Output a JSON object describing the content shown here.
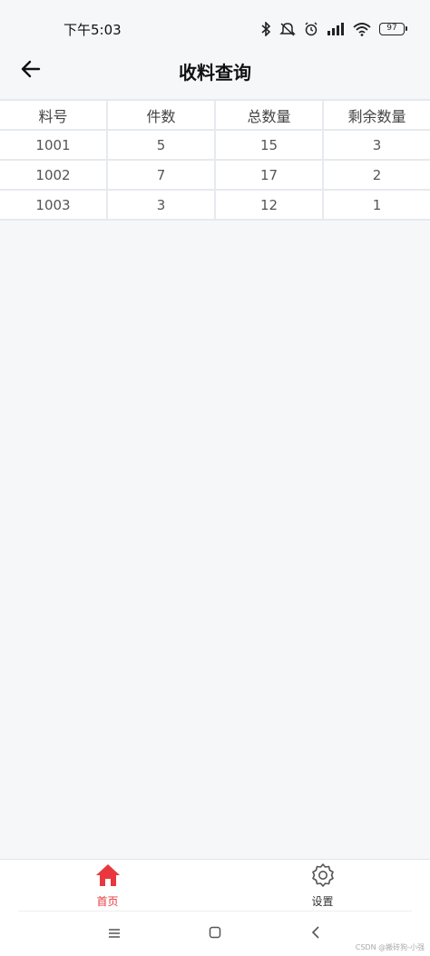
{
  "status_bar": {
    "time": "下午5:03",
    "battery": "97",
    "icons": [
      "bluetooth-icon",
      "mute-icon",
      "alarm-icon",
      "signal-icon",
      "wifi-icon",
      "battery-icon"
    ]
  },
  "app_bar": {
    "title": "收料查询",
    "back_icon": "arrow-left-icon"
  },
  "table": {
    "headers": [
      "料号",
      "件数",
      "总数量",
      "剩余数量"
    ],
    "rows": [
      [
        "1001",
        "5",
        "15",
        "3"
      ],
      [
        "1002",
        "7",
        "17",
        "2"
      ],
      [
        "1003",
        "3",
        "12",
        "1"
      ]
    ]
  },
  "tab_bar": {
    "tabs": [
      {
        "label": "首页",
        "icon": "home-icon",
        "active": true,
        "color": "#e8383d"
      },
      {
        "label": "设置",
        "icon": "gear-icon",
        "active": false,
        "color": "#333333"
      }
    ]
  },
  "nav_bar": {
    "icons": [
      "menu-icon",
      "home-square-icon",
      "back-chevron-icon"
    ]
  },
  "watermark": "CSDN @搬砖狗-小强",
  "colors": {
    "accent": "#e8383d",
    "background": "#f6f7f9",
    "table_border": "#e6eaee"
  }
}
